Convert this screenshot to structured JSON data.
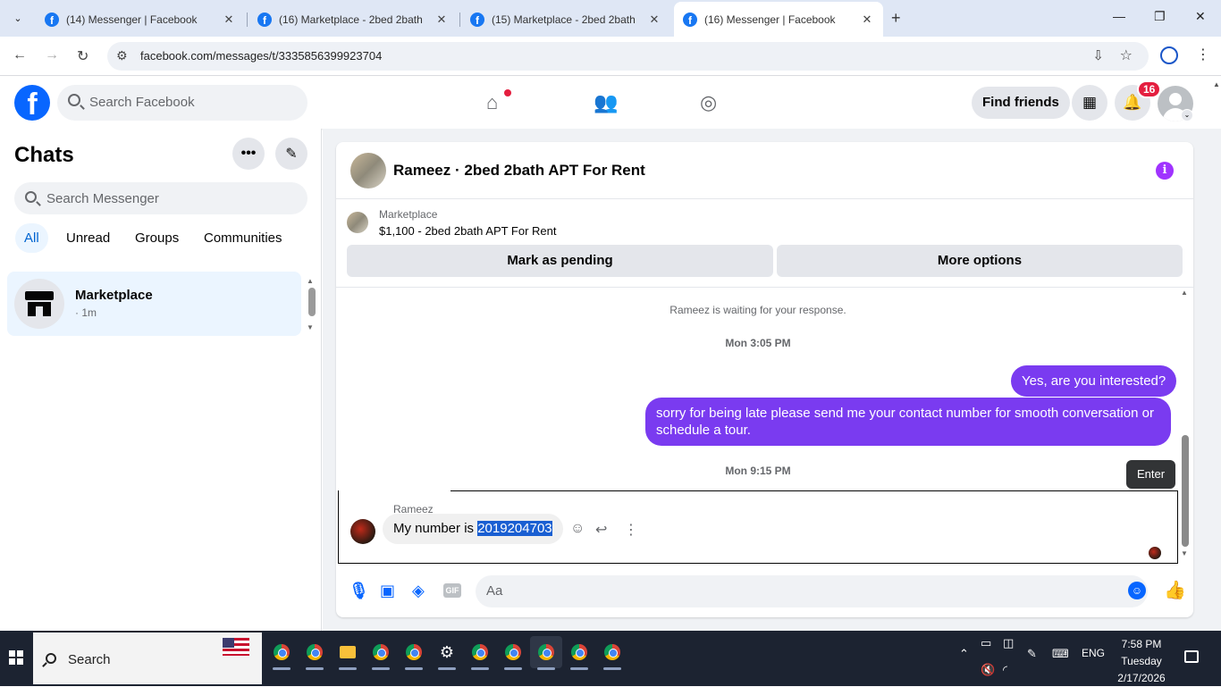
{
  "browser": {
    "tabs": [
      {
        "title": "(14) Messenger | Facebook",
        "active": false
      },
      {
        "title": "(16) Marketplace - 2bed 2bath",
        "active": false
      },
      {
        "title": "(15) Marketplace - 2bed 2bath",
        "active": false
      },
      {
        "title": "(16) Messenger | Facebook",
        "active": true
      }
    ],
    "url": "facebook.com/messages/t/3335856399923704"
  },
  "facebook": {
    "search_placeholder": "Search Facebook",
    "find_friends_label": "Find friends",
    "notification_count": "16"
  },
  "sidebar": {
    "title": "Chats",
    "search_placeholder": "Search Messenger",
    "filters": [
      "All",
      "Unread",
      "Groups",
      "Communities"
    ],
    "chats": [
      {
        "name": "Marketplace",
        "time": "· 1m"
      }
    ]
  },
  "conversation": {
    "title": "Rameez · 2bed 2bath APT For Rent",
    "listing_label": "Marketplace",
    "listing_price": "$1,100 - 2bed 2bath APT For Rent",
    "mark_pending_label": "Mark as pending",
    "more_options_label": "More options",
    "system_message": "Rameez is waiting for your response.",
    "timestamp_1": "Mon 3:05 PM",
    "out_message_1": "Yes, are you interested?",
    "out_message_2": "sorry for being late please send me your contact number for smooth conversation or schedule a tour.",
    "timestamp_2": "Mon 9:15 PM",
    "sender_name": "Rameez",
    "in_message_prefix": "My number is ",
    "in_message_selected": "2019204703",
    "tooltip": "Enter",
    "composer_placeholder": "Aa"
  },
  "taskbar": {
    "search_label": "Search",
    "language": "ENG",
    "time": "7:58 PM",
    "day": "Tuesday",
    "date": "2/17/2026"
  },
  "colors": {
    "facebook_blue": "#0866ff",
    "outgoing_bubble": "#7a3bf0",
    "selection_highlight": "#1a5fd2"
  }
}
